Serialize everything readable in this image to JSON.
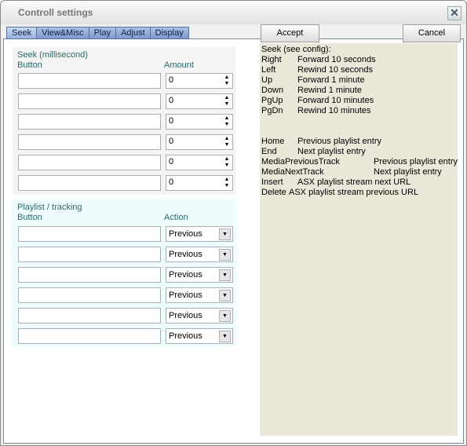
{
  "window": {
    "title": "Controll settings"
  },
  "tabs": [
    {
      "label": "Seek",
      "active": true
    },
    {
      "label": "View&Misc",
      "active": false
    },
    {
      "label": "Play",
      "active": false
    },
    {
      "label": "Adjust",
      "active": false
    },
    {
      "label": "Display",
      "active": false
    }
  ],
  "buttons": {
    "accept": "Accept",
    "cancel": "Cancel"
  },
  "seek": {
    "title": "Seek (millisecond)",
    "col_button": "Button",
    "col_amount": "Amount",
    "rows": [
      {
        "button": "",
        "amount": "0"
      },
      {
        "button": "",
        "amount": "0"
      },
      {
        "button": "",
        "amount": "0"
      },
      {
        "button": "",
        "amount": "0"
      },
      {
        "button": "",
        "amount": "0"
      },
      {
        "button": "",
        "amount": "0"
      }
    ]
  },
  "playlist": {
    "title": "Playlist / tracking",
    "col_button": "Button",
    "col_action": "Action",
    "rows": [
      {
        "button": "",
        "action": "Previous"
      },
      {
        "button": "",
        "action": "Previous"
      },
      {
        "button": "",
        "action": "Previous"
      },
      {
        "button": "",
        "action": "Previous"
      },
      {
        "button": "",
        "action": "Previous"
      },
      {
        "button": "",
        "action": "Previous"
      }
    ]
  },
  "help": {
    "heading": "Seek (see config):",
    "lines": [
      {
        "key": "Right",
        "desc": "Forward 10 seconds"
      },
      {
        "key": "Left",
        "desc": "Rewind 10 seconds"
      },
      {
        "key": "Up",
        "desc": "Forward 1 minute"
      },
      {
        "key": "Down",
        "desc": "Rewind 1 minute"
      },
      {
        "key": "PgUp",
        "desc": "Forward 10 minutes"
      },
      {
        "key": "PgDn",
        "desc": "Rewind 10 minutes"
      },
      {
        "key": "Home",
        "desc": "Previous playlist entry"
      },
      {
        "key": "End",
        "desc": "Next playlist entry"
      },
      {
        "key": "MediaPreviousTrack",
        "desc": "Previous playlist entry"
      },
      {
        "key": "MediaNextTrack",
        "desc": "Next playlist entry"
      },
      {
        "key": "Insert",
        "desc": "ASX playlist stream next URL"
      },
      {
        "key": "Delete",
        "desc": "ASX playlist stream previous URL"
      }
    ]
  }
}
